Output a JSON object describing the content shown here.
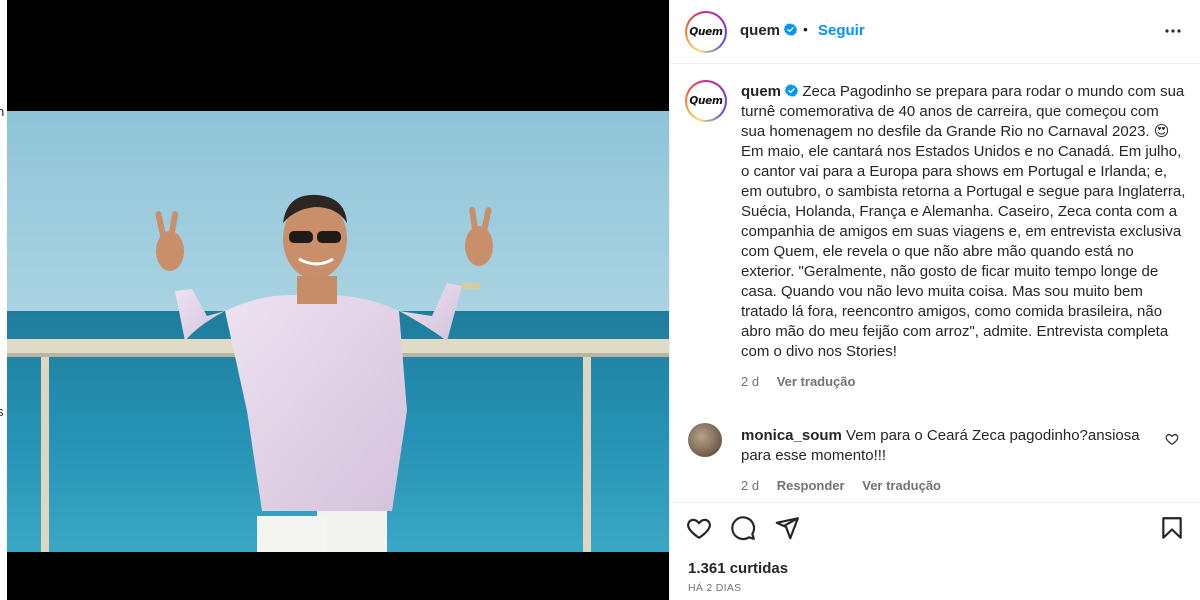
{
  "post": {
    "username": "quem",
    "avatar_logo": "Quem",
    "follow_label": "Seguir",
    "dot": "•",
    "caption": {
      "username": "quem",
      "text": "Zeca Pagodinho se prepara para rodar o mundo com sua turnê comemorativa de 40 anos de carreira, que começou com sua homenagem no desfile da Grande Rio no Carnaval 2023. 😍 Em maio, ele cantará nos Estados Unidos e no Canadá. Em julho, o cantor vai para a Europa para shows em Portugal e Irlanda; e, em outubro, o sambista retorna a Portugal e segue para Inglaterra, Suécia, Holanda, França e Alemanha. Caseiro, Zeca conta com a companhia de amigos em suas viagens e, em entrevista exclusiva com Quem, ele revela o que não abre mão quando está no exterior. \"Geralmente, não gosto de ficar muito tempo longe de casa. Quando vou não levo muita coisa. Mas sou muito bem tratado lá fora, reencontro amigos, como comida brasileira, não abro mão do meu feijão com arroz\", admite. Entrevista completa com o divo nos Stories!",
      "age": "2 d",
      "translate_label": "Ver tradução"
    },
    "comments": [
      {
        "username": "monica_soum",
        "text": "Vem para o Ceará Zeca pagodinho?ansiosa para esse momento!!!",
        "age": "2 d",
        "reply_label": "Responder",
        "translate_label": "Ver tradução"
      }
    ],
    "likes": "1.361 curtidas",
    "posted_ago": "HÁ 2 DIAS"
  },
  "edge_fragments": [
    "n",
    "s"
  ],
  "icons": [
    "verified-badge-icon",
    "more-options-icon",
    "heart-icon",
    "comment-icon",
    "share-icon",
    "bookmark-icon"
  ],
  "colors": {
    "accent": "#0095f6",
    "text": "#262626",
    "muted": "#737373",
    "border": "#efefef"
  }
}
